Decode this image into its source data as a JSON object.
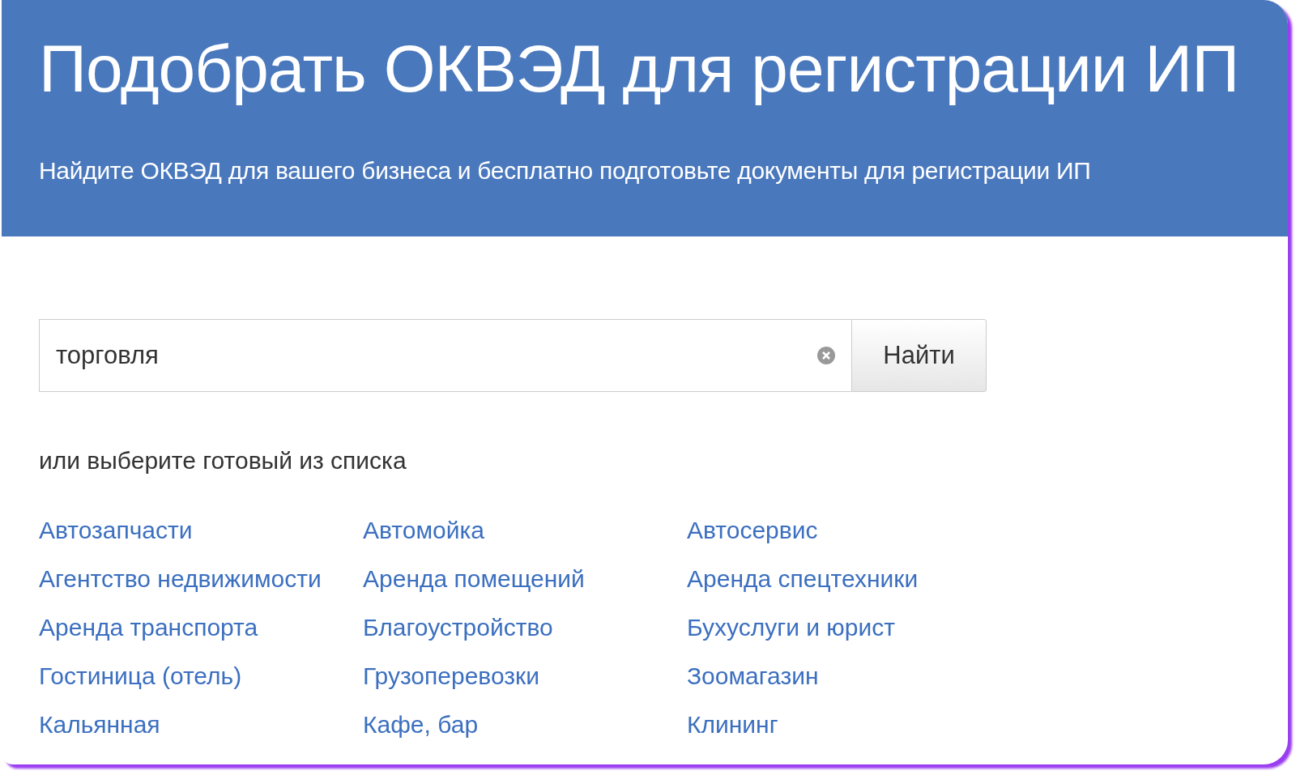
{
  "header": {
    "title": "Подобрать ОКВЭД для регистрации ИП",
    "subtitle": "Найдите ОКВЭД для вашего бизнеса и бесплатно подготовьте документы для регистрации ИП"
  },
  "search": {
    "value": "торговля",
    "button": "Найти"
  },
  "list_label": "или выберите готовый из списка",
  "links": [
    "Автозапчасти",
    "Автомойка",
    "Автосервис",
    "Агентство недвижимости",
    "Аренда помещений",
    "Аренда спецтехники",
    "Аренда транспорта",
    "Благоустройство",
    "Бухуслуги и юрист",
    "Гостиница (отель)",
    "Грузоперевозки",
    "Зоомагазин",
    "Кальянная",
    "Кафе, бар",
    "Клининг"
  ]
}
